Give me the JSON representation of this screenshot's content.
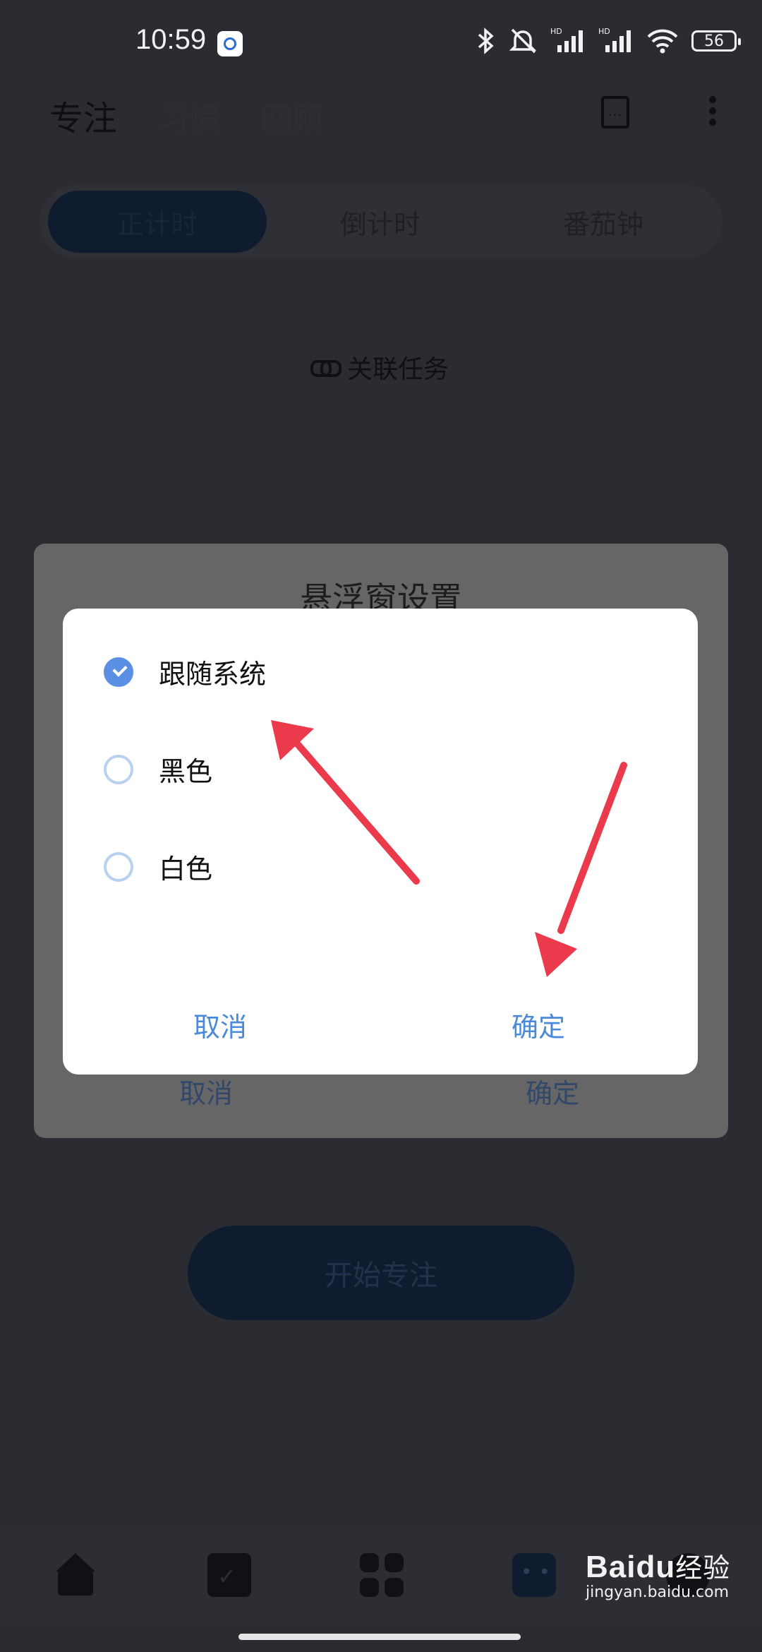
{
  "status_bar": {
    "time": "10:59",
    "battery": "56"
  },
  "header": {
    "tabs": [
      "专注",
      "习惯",
      "回顾"
    ]
  },
  "mode_tabs": [
    "正计时",
    "倒计时",
    "番茄钟"
  ],
  "link_task_label": "关联任务",
  "background_dialog": {
    "title": "悬浮窗设置",
    "cancel": "取消",
    "confirm": "确定"
  },
  "theme_dialog": {
    "options": [
      {
        "label": "跟随系统",
        "selected": true
      },
      {
        "label": "黑色",
        "selected": false
      },
      {
        "label": "白色",
        "selected": false
      }
    ],
    "cancel": "取消",
    "confirm": "确定"
  },
  "start_button": "开始专注",
  "watermark": {
    "brand_latin": "Bai",
    "brand_cn": "经验",
    "brand_du": "du",
    "site": "jingyan.baidu.com"
  },
  "colors": {
    "accent": "#4a8ad8",
    "checked": "#5a8fe4",
    "arrow": "#ea3a4c",
    "overlay": "#2b2c31"
  }
}
